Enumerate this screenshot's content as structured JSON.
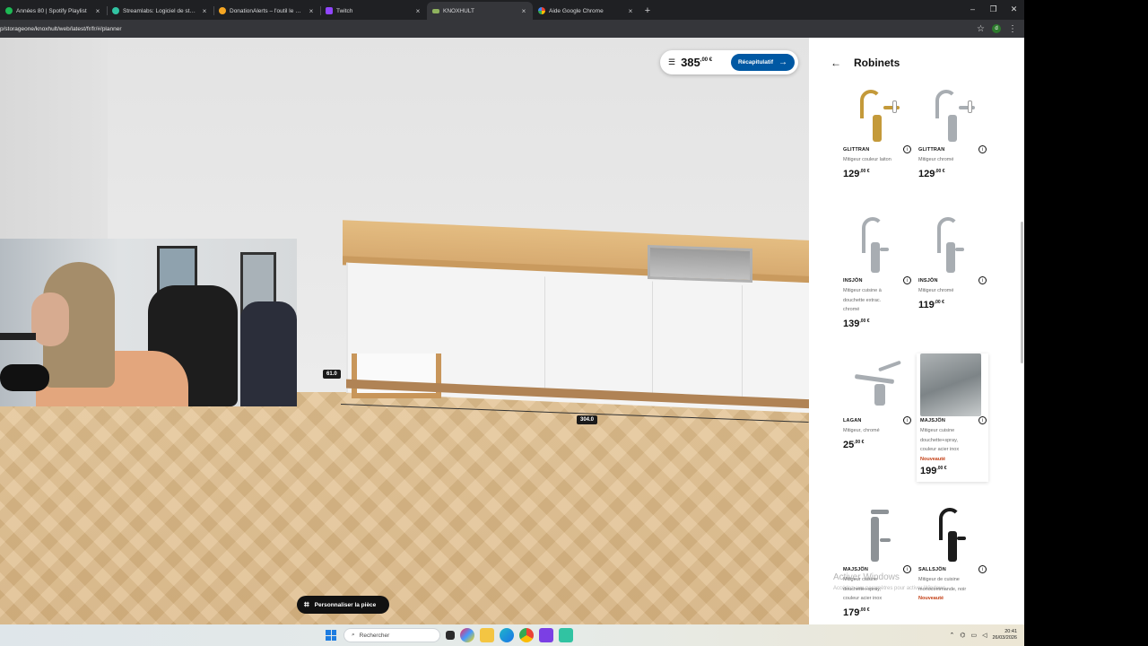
{
  "browser": {
    "tabs": [
      {
        "title": "Années 80 | Spotify Playlist",
        "color": "#1db954",
        "active": false
      },
      {
        "title": "Streamlabs: Logiciel de streamin",
        "color": "#31c3a2",
        "active": false
      },
      {
        "title": "DonationAlerts – l'outil le plus",
        "color": "#f5a623",
        "active": false
      },
      {
        "title": "Twitch",
        "color": "#9146ff",
        "active": false
      },
      {
        "title": "KNOXHULT",
        "color": "#8fb35e",
        "active": true
      },
      {
        "title": "Aide Google Chrome",
        "color": "#4285f4",
        "active": false
      }
    ],
    "url": "p/storageone/knoxhult/web/latest/fr/fr/#/planner",
    "close_glyph": "×",
    "new_tab_glyph": "+",
    "window_controls": {
      "minimize": "–",
      "maximize": "❐",
      "close": "✕"
    }
  },
  "planner": {
    "total_price_main": "385",
    "total_price_sup": ",00 €",
    "recap_label": "Récapitulatif",
    "customize_label": "Personnaliser la pièce",
    "dimensions": {
      "height_label": "61.0",
      "width_label": "304.0"
    }
  },
  "panel": {
    "title": "Robinets",
    "products": [
      {
        "name": "GLITTRAN",
        "desc": "Mitigeur couleur laiton",
        "price": "129",
        "price_sup": ",00 €",
        "new": "",
        "color": "#c49a3a"
      },
      {
        "name": "GLITTRAN",
        "desc": "Mitigeur chromé",
        "price": "129",
        "price_sup": ",00 €",
        "new": "",
        "color": "#9ea3a8"
      },
      {
        "name": "INSJÖN",
        "desc": "Mitigeur cuisine à douchette extrac. chromé",
        "price": "139",
        "price_sup": ",00 €",
        "new": "",
        "color": "#9ea3a8"
      },
      {
        "name": "INSJÖN",
        "desc": "Mitigeur chromé",
        "price": "119",
        "price_sup": ",00 €",
        "new": "",
        "color": "#9ea3a8"
      },
      {
        "name": "LAGAN",
        "desc": "Mitigeur, chromé",
        "price": "25",
        "price_sup": ",00 €",
        "new": "",
        "color": "#9ea3a8"
      },
      {
        "name": "MAJSJÖN",
        "desc": "Mitigeur cuisine douchette+spray, couleur acier inox",
        "price": "199",
        "price_sup": ",00 €",
        "new": "Nouveauté",
        "color": "#8d9296"
      },
      {
        "name": "MAJSJÖN",
        "desc": "Mitigeur cuisine douchette+spray, couleur acier inox",
        "price": "179",
        "price_sup": ",00 €",
        "new": "",
        "color": "#8d9296"
      },
      {
        "name": "SALLSJÖN",
        "desc": "Mitigeur de cuisine monocommande, noir",
        "price": "",
        "price_sup": "",
        "new": "Nouveauté",
        "color": "#1c1c1c"
      }
    ]
  },
  "os": {
    "watermark": "Activer Windows",
    "watermark_sub": "Accédez aux paramètres pour activer Windows.",
    "search_placeholder": "Rechercher",
    "time": "20:41",
    "date": "26/03/2026"
  }
}
